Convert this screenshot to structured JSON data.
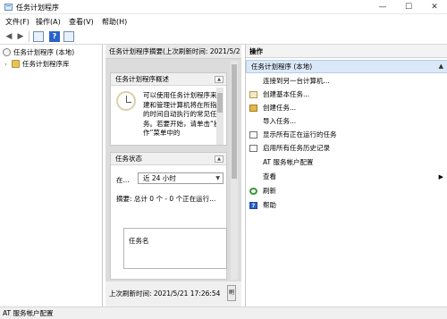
{
  "window": {
    "title": "任务计划程序",
    "minimize_glyph": "—",
    "maximize_glyph": "☐",
    "close_glyph": "✕"
  },
  "menu": [
    "文件(F)",
    "操作(A)",
    "查看(V)",
    "帮助(H)"
  ],
  "toolbar": {
    "back_glyph": "◀",
    "forward_glyph": "▶",
    "help_glyph": "?"
  },
  "tree": {
    "root": "任务计划程序 (本地)",
    "child": "任务计划程序库",
    "child_chevron": "›"
  },
  "middle": {
    "header": "任务计划程序摘要(上次刷新时间: 2021/5/2",
    "overview": {
      "title": "任务计划程序概述",
      "text": "可以使用任务计划程序来创建和管理计算机将在所指定的时间自动执行的常见任务。若要开始，请单击“操作”菜单中的"
    },
    "status": {
      "title": "任务状态",
      "label": "在...",
      "range": "近 24 小时",
      "summary": "摘要: 总计 0 个 - 0 个正在运行...",
      "task_header": "任务名"
    },
    "collapse_glyph": "▲",
    "last_refresh": "上次刷新时间: 2021/5/21 17:26:54",
    "refresh_button": "刷"
  },
  "actions": {
    "header": "操作",
    "section": "任务计划程序 (本地)",
    "section_glyph": "▲",
    "items": [
      {
        "label": "连接到另一台计算机...",
        "icon": "none"
      },
      {
        "label": "创建基本任务...",
        "icon": "task-icon"
      },
      {
        "label": "创建任务...",
        "icon": "new-task-icon"
      },
      {
        "label": "导入任务...",
        "icon": "none"
      },
      {
        "label": "显示所有正在运行的任务",
        "icon": "list-icon"
      },
      {
        "label": "启用所有任务历史记录",
        "icon": "history-icon"
      },
      {
        "label": "AT 服务帐户配置",
        "icon": "none"
      },
      {
        "label": "查看",
        "icon": "none",
        "submenu": "▶"
      },
      {
        "label": "刷新",
        "icon": "refresh-icon"
      },
      {
        "label": "帮助",
        "icon": "help-icon",
        "glyph": "?"
      }
    ]
  },
  "statusbar": {
    "text": "AT 服务帐户配置"
  }
}
